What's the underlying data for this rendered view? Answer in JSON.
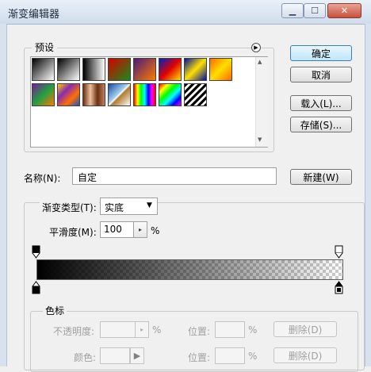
{
  "window": {
    "title": "渐变编辑器",
    "minimize_icon": "minimize-icon",
    "maximize_icon": "maximize-icon",
    "close_icon": "close-icon"
  },
  "presets": {
    "label": "预设",
    "menu_icon": "right-arrow-circle-icon",
    "swatches": [
      {
        "name": "foreground-to-background",
        "style": "linear-gradient(135deg,#000 0%,#fff 100%)"
      },
      {
        "name": "foreground-to-transparent",
        "style": "linear-gradient(135deg,#000,rgba(0,0,0,0))"
      },
      {
        "name": "black-white",
        "style": "linear-gradient(to right,#000,#fff)"
      },
      {
        "name": "red-green",
        "style": "linear-gradient(135deg,#d40000,#1a8c1a)"
      },
      {
        "name": "violet-orange",
        "style": "linear-gradient(135deg,#4a1a7a,#ff7a00)"
      },
      {
        "name": "blue-red-yellow",
        "style": "linear-gradient(135deg,#0020c0,#e00000,#ffe000)"
      },
      {
        "name": "blue-yellow-blue",
        "style": "linear-gradient(135deg,#0010a0,#ffe000,#0010a0)"
      },
      {
        "name": "orange-yellow-orange",
        "style": "linear-gradient(135deg,#ff6a00,#ffe000,#ff6a00)"
      },
      {
        "name": "violet-green-orange",
        "style": "linear-gradient(135deg,#7a1a9a,#20a040,#ff7a00)"
      },
      {
        "name": "yellow-violet-orange-blue",
        "style": "linear-gradient(135deg,#ffd000,#8a2ab0,#ff7000,#2050c0)"
      },
      {
        "name": "copper",
        "style": "linear-gradient(to right,#6a3010,#f0c0a0,#6a3010,#c08060)"
      },
      {
        "name": "chrome",
        "style": "linear-gradient(135deg,#1a4aa0 0%,#a0d0f0 45%,#ffffff 50%,#b07a30 55%,#ffffff 100%)"
      },
      {
        "name": "spectrum",
        "style": "linear-gradient(to right,#f00,#ff0,#0f0,#0ff,#00f,#f0f,#f00)"
      },
      {
        "name": "transparent-rainbow",
        "style": "linear-gradient(135deg,#f00,#ff0,#0f0,#0ff,#00f,#f0f)"
      },
      {
        "name": "transparent-stripes",
        "style": "repeating-linear-gradient(135deg,#000 0 3px,#fff 3px 6px)"
      }
    ]
  },
  "buttons": {
    "ok": "确定",
    "cancel": "取消",
    "load": "载入(L)...",
    "save": "存储(S)...",
    "new": "新建(W)"
  },
  "name_row": {
    "label": "名称(N):",
    "value": "自定"
  },
  "gradient_type": {
    "label": "渐变类型(T):",
    "selected": "实底"
  },
  "smoothness": {
    "label": "平滑度(M):",
    "value": "100",
    "unit": "%"
  },
  "color_stops": {
    "label": "色标",
    "opacity_label": "不透明度:",
    "opacity_unit": "%",
    "location_label": "位置:",
    "location_unit": "%",
    "delete_label": "删除(D)",
    "color_label": "颜色:",
    "location2_label": "位置:",
    "location2_unit": "%",
    "delete2_label": "删除(D)"
  },
  "colors": {
    "default_button": "#bee6fd",
    "titlebar": "#cfdceb",
    "close_button": "#c8503b"
  }
}
